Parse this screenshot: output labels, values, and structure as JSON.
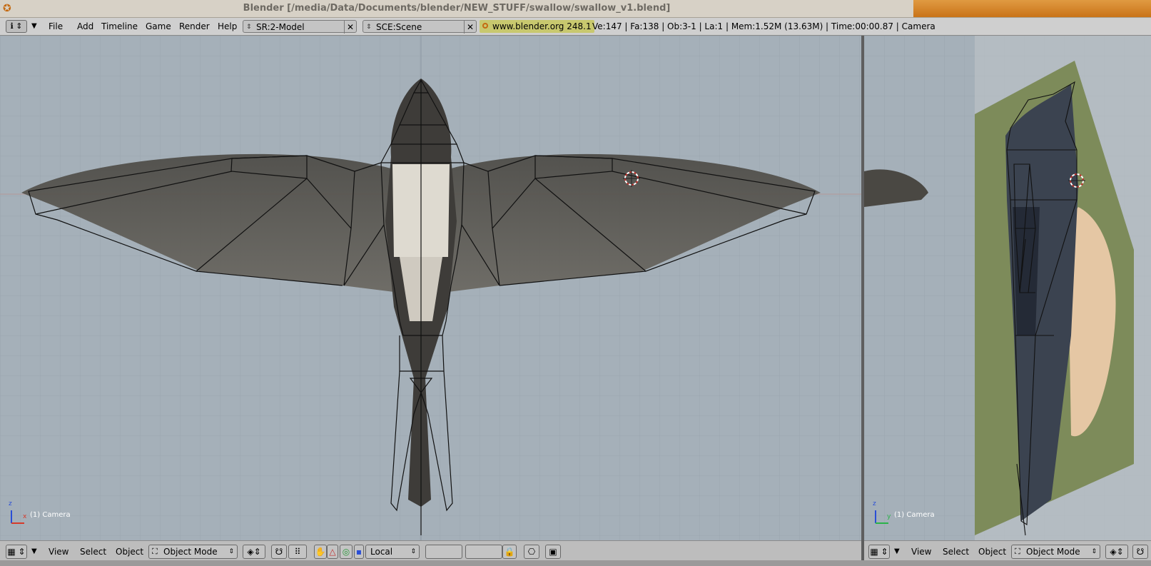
{
  "window": {
    "title": "Blender [/media/Data/Documents/blender/NEW_STUFF/swallow/swallow_v1.blend]"
  },
  "header": {
    "menus": [
      "File",
      "Add",
      "Timeline",
      "Game",
      "Render",
      "Help"
    ],
    "screen_field": "SR:2-Model",
    "scene_field": "SCE:Scene",
    "version_link": "www.blender.org 248.1",
    "stats": "Ve:147 | Fa:138 | Ob:3-1 | La:1  | Mem:1.52M (13.63M)  | Time:00:00.87 | Camera"
  },
  "viewports": {
    "front": {
      "label": "(1) Camera",
      "axis_labels": [
        "z",
        "x"
      ]
    },
    "side": {
      "label": "(1) Camera",
      "axis_labels": [
        "z",
        "y"
      ]
    }
  },
  "front_header": {
    "menus": [
      "View",
      "Select",
      "Object"
    ],
    "mode": "Object Mode",
    "pivot": "Local"
  },
  "side_header": {
    "menus": [
      "View",
      "Select",
      "Object"
    ],
    "mode": "Object Mode"
  },
  "colors": {
    "accent_orange": "#c97318",
    "viewport_bg": "#a5b0b9",
    "wire": "#111111"
  }
}
